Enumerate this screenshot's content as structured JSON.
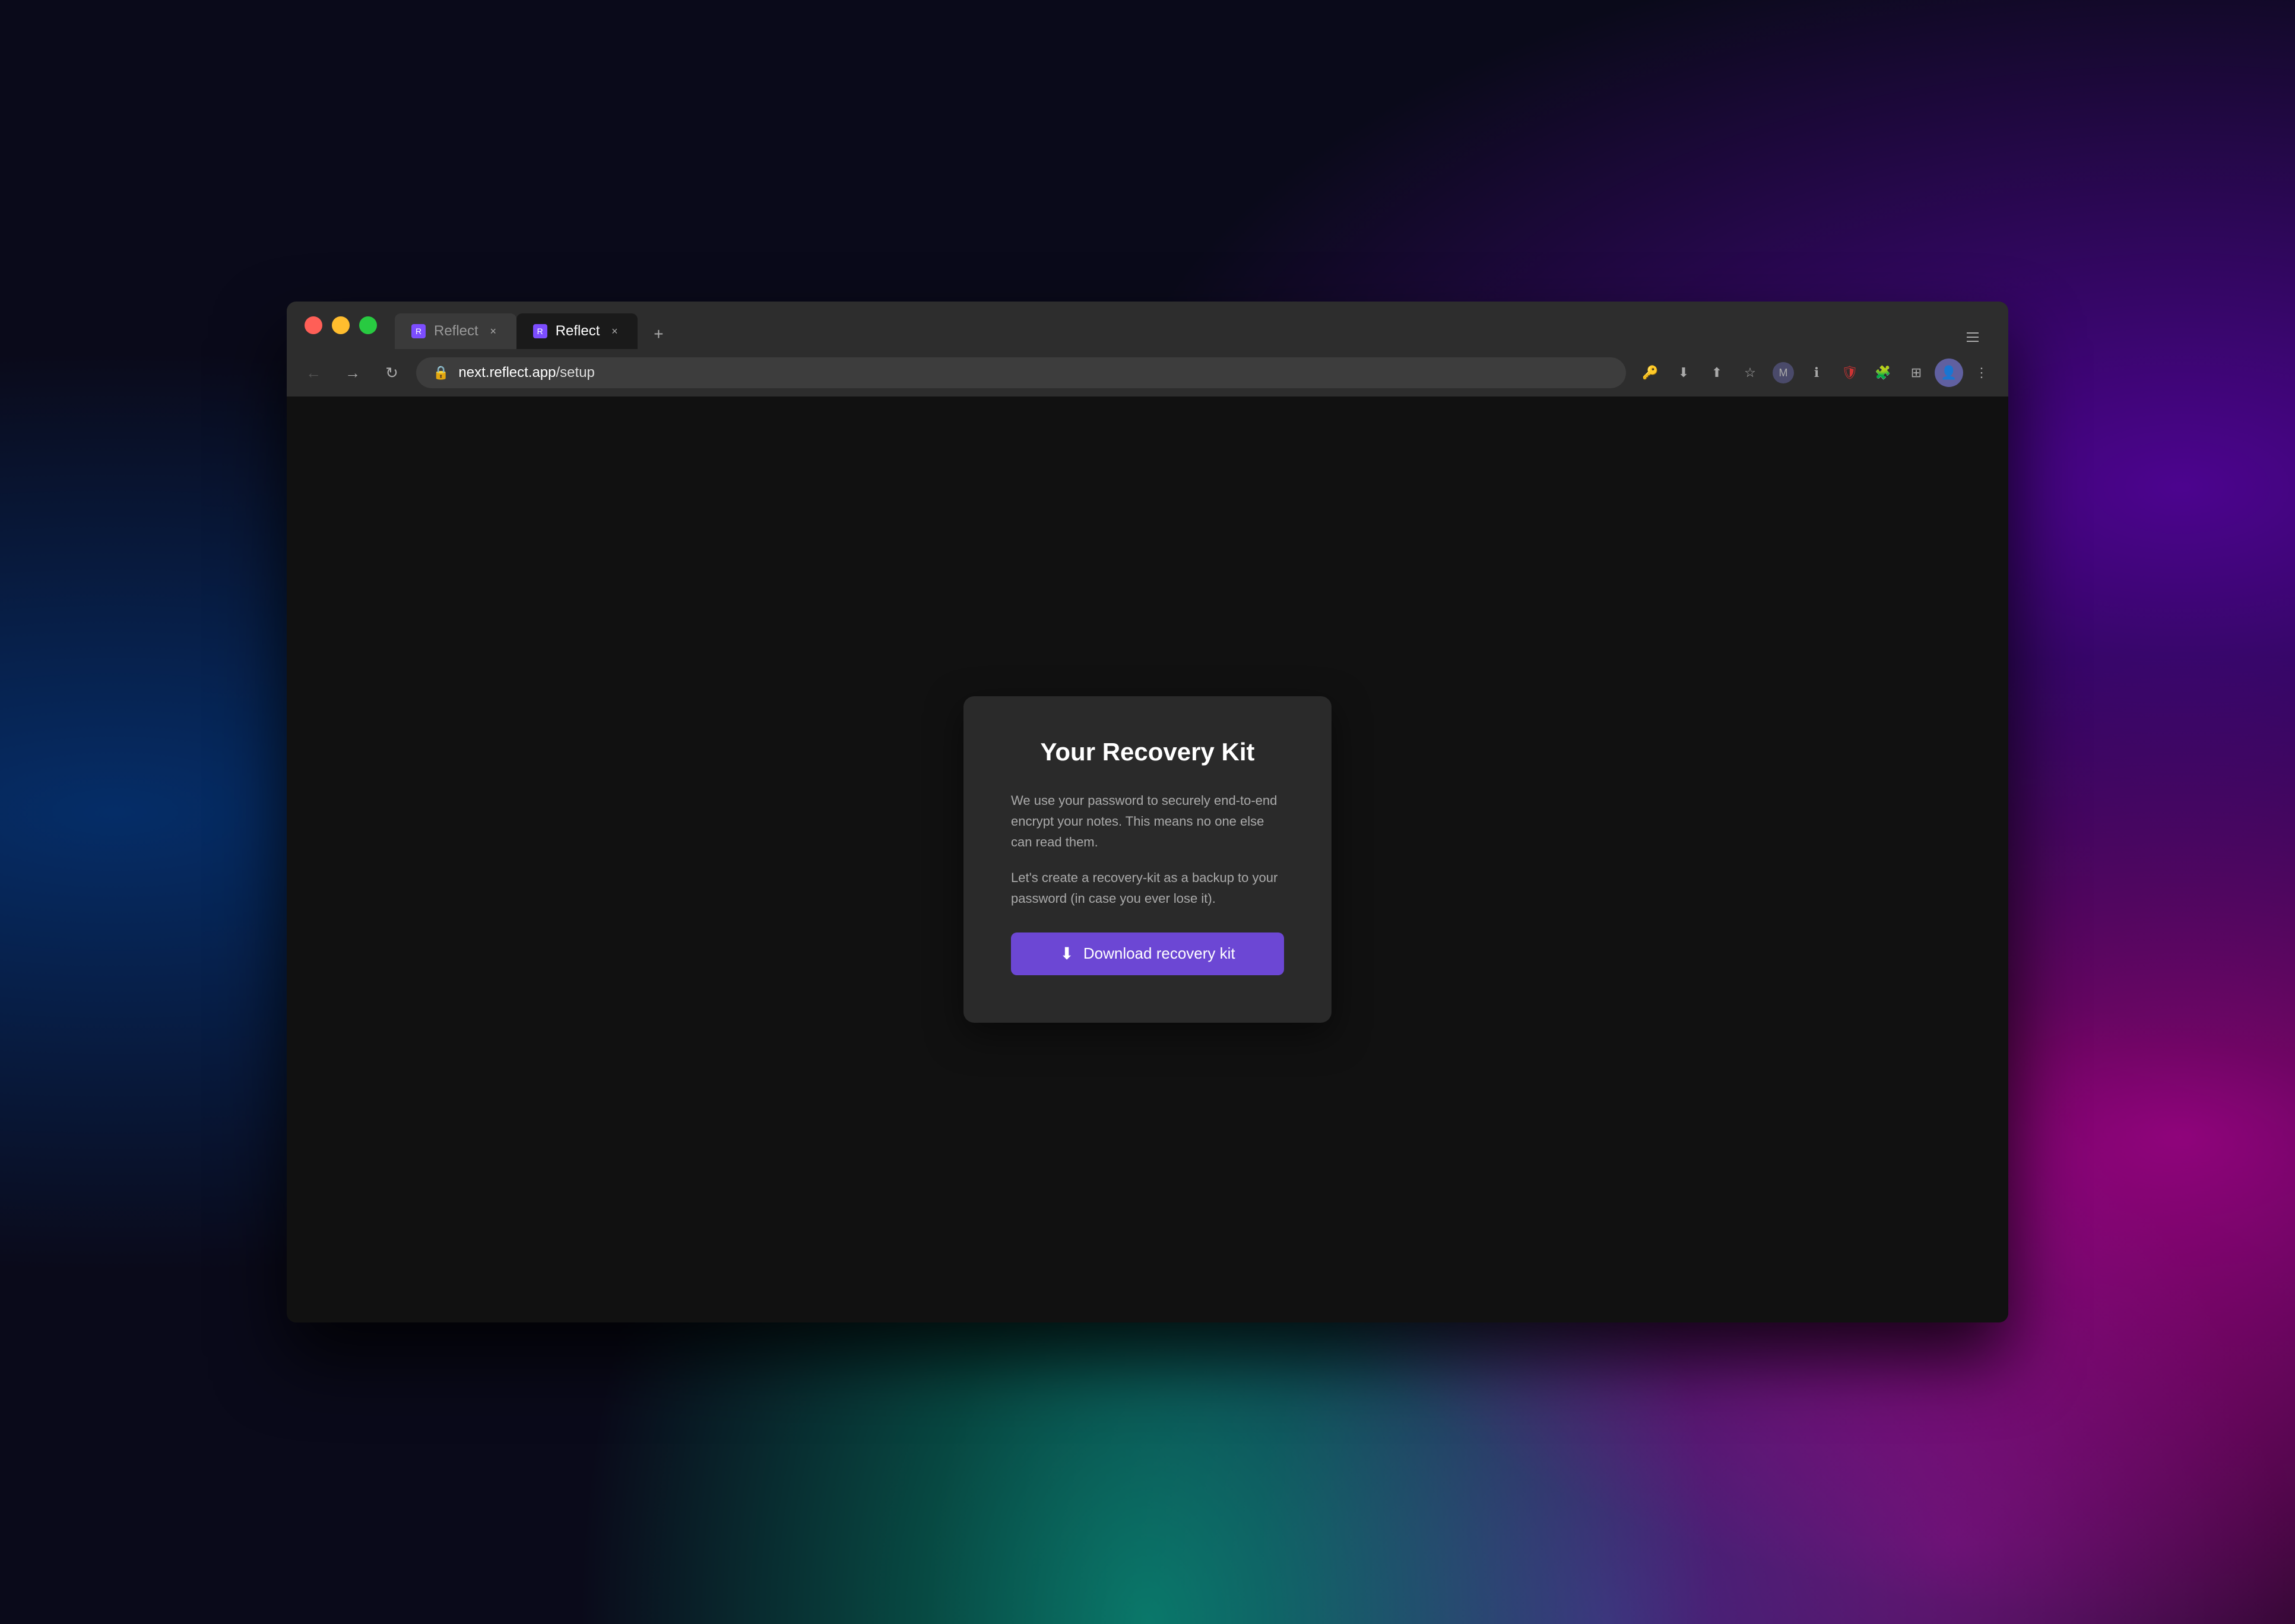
{
  "desktop": {},
  "browser": {
    "tabs": [
      {
        "label": "Reflect",
        "url": "",
        "active": false,
        "favicon_color": "#7c4dff"
      },
      {
        "label": "Reflect",
        "url": "",
        "active": true,
        "favicon_color": "#7c4dff"
      }
    ],
    "new_tab_label": "+",
    "address_bar": {
      "url_prefix": "next.reflect.app",
      "url_path": "/setup",
      "lock_icon": "🔒"
    },
    "nav": {
      "back_icon": "←",
      "forward_icon": "→",
      "refresh_icon": "↻"
    }
  },
  "card": {
    "title": "Your Recovery Kit",
    "paragraph1": "We use your password to securely end-to-end encrypt your notes. This means no one else can read them.",
    "paragraph2": "Let's create a recovery-kit as a backup to your password (in case you ever lose it).",
    "button_label": "Download recovery kit",
    "download_icon": "⬇"
  },
  "colors": {
    "button_bg": "#6c47d4",
    "card_bg": "#2a2a2a",
    "browser_bg": "#111111"
  }
}
